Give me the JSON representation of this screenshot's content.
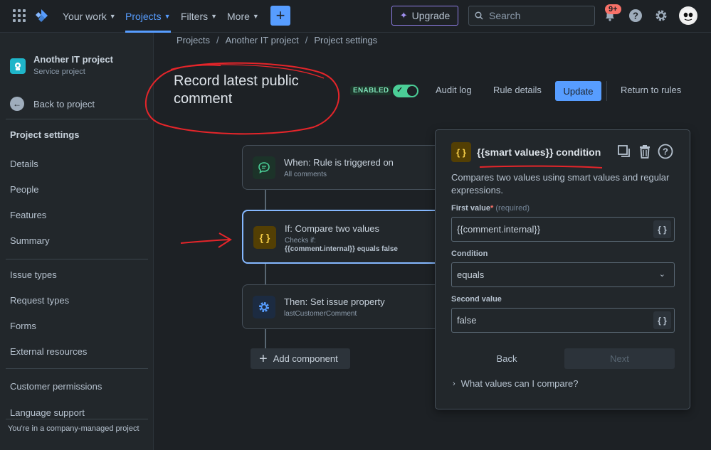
{
  "topnav": {
    "your_work": "Your work",
    "projects": "Projects",
    "filters": "Filters",
    "more": "More",
    "create": "+",
    "upgrade": "Upgrade",
    "search_placeholder": "Search",
    "notifications_badge": "9+"
  },
  "sidebar": {
    "project_name": "Another IT project",
    "project_type": "Service project",
    "back_to_project": "Back to project",
    "section_title": "Project settings",
    "items_group1": [
      "Details",
      "People",
      "Features",
      "Summary"
    ],
    "items_group2": [
      "Issue types",
      "Request types",
      "Forms",
      "External resources"
    ],
    "items_group3": [
      "Customer permissions",
      "Language support"
    ],
    "footer": "You're in a company-managed project"
  },
  "breadcrumb": [
    "Projects",
    "Another IT project",
    "Project settings"
  ],
  "rule": {
    "title": "Record latest public comment",
    "status": "ENABLED",
    "audit_log": "Audit log",
    "rule_details": "Rule details",
    "update": "Update",
    "return_to_rules": "Return to rules"
  },
  "flow": {
    "trigger": {
      "title": "When: Rule is triggered on",
      "sub": "All comments"
    },
    "condition": {
      "title": "If: Compare two values",
      "sub": "Checks if:",
      "detail": "{{comment.internal}} equals false"
    },
    "action": {
      "title": "Then: Set issue property",
      "sub": "lastCustomerComment"
    },
    "add_component": "Add component"
  },
  "panel": {
    "title": "{{smart values}} condition",
    "description": "Compares two values using smart values and regular expressions.",
    "first_value_label": "First value",
    "required_marker": "*",
    "required_hint": "(required)",
    "first_value": "{{comment.internal}}",
    "condition_label": "Condition",
    "condition_value": "equals",
    "second_value_label": "Second value",
    "second_value": "false",
    "back": "Back",
    "next": "Next",
    "expander": "What values can I compare?"
  },
  "colors": {
    "accent": "#579dff",
    "annotation": "#e5252a",
    "enabled": "#4bce97"
  }
}
